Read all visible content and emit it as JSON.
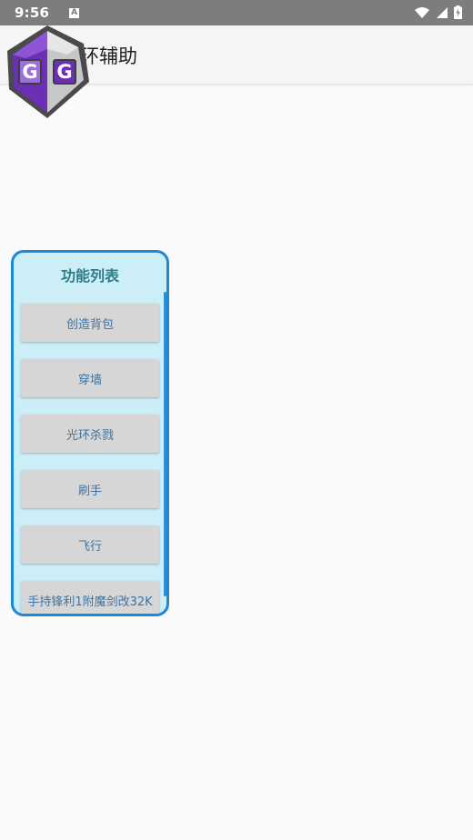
{
  "status_bar": {
    "time": "9:56",
    "notification_icon": "A",
    "icons": [
      "wifi-icon",
      "cellular-signal-icon",
      "battery-charging-icon"
    ]
  },
  "app_bar": {
    "title": "环辅助"
  },
  "logo": {
    "text": "GG",
    "colors": {
      "left": "#6a2fb5",
      "right": "#c7c7c7",
      "border": "#4a4a4a"
    }
  },
  "panel": {
    "title": "功能列表",
    "accent": "#1e88d8",
    "background": "#cbeef7",
    "items": [
      {
        "label": "创造背包"
      },
      {
        "label": "穿墙"
      },
      {
        "label": "光环杀戮"
      },
      {
        "label": "刷手"
      },
      {
        "label": "飞行"
      },
      {
        "label": "手持锋利1附魔剑改32K"
      }
    ]
  }
}
